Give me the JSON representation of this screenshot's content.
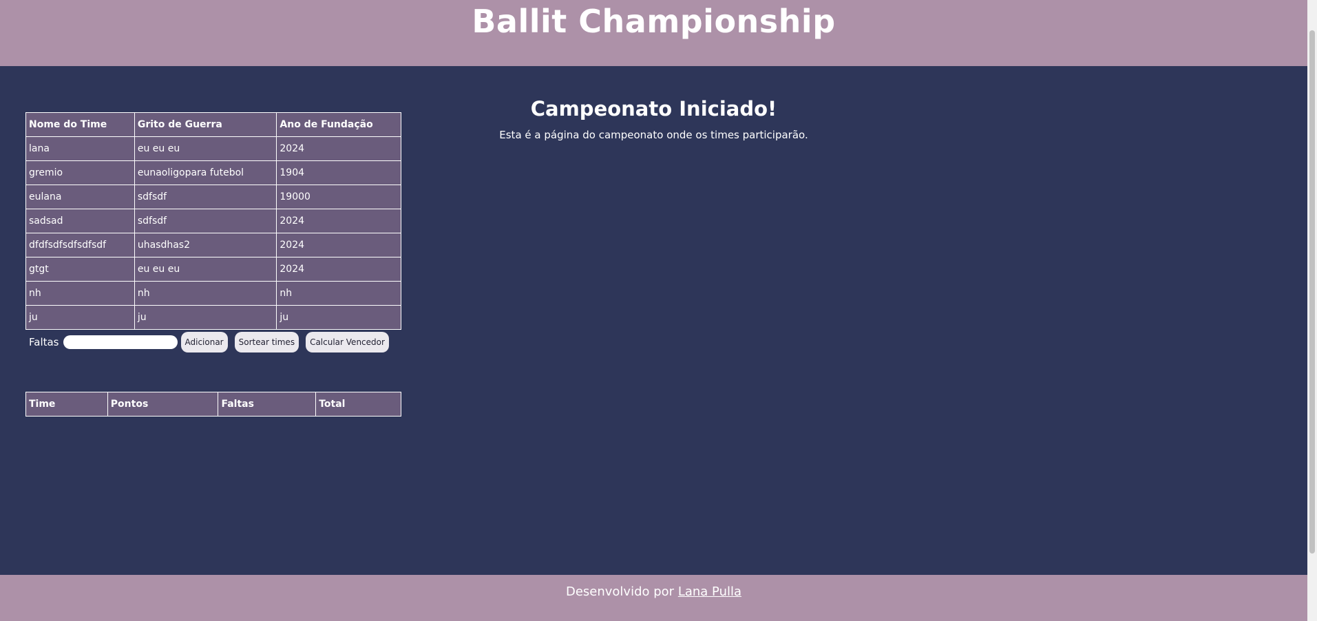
{
  "header": {
    "title": "Ballit Championship"
  },
  "main": {
    "title": "Campeonato Iniciado!",
    "subtitle": "Esta é a página do campeonato onde os times participarão."
  },
  "teams_table": {
    "headers": [
      "Nome do Time",
      "Grito de Guerra",
      "Ano de Fundação"
    ],
    "rows": [
      [
        "lana",
        "eu eu eu",
        "2024"
      ],
      [
        "gremio",
        "eunaoligopara futebol",
        "1904"
      ],
      [
        "eulana",
        "sdfsdf",
        "19000"
      ],
      [
        "sadsad",
        "sdfsdf",
        "2024"
      ],
      [
        "dfdfsdfsdfsdfsdf",
        "uhasdhas2",
        "2024"
      ],
      [
        "gtgt",
        "eu eu eu",
        "2024"
      ],
      [
        "nh",
        "nh",
        "nh"
      ],
      [
        "ju",
        "ju",
        "ju"
      ]
    ]
  },
  "controls": {
    "faltas_label": "Faltas",
    "faltas_value": "",
    "add_label": "Adicionar",
    "shuffle_label": "Sortear times",
    "winner_label": "Calcular Vencedor"
  },
  "results_table": {
    "headers": [
      "Time",
      "Pontos",
      "Faltas",
      "Total"
    ],
    "rows": []
  },
  "footer": {
    "prefix": "Desenvolvido por",
    "author": "Lana Pulla"
  },
  "colors": {
    "header_bg": "#ad91a8",
    "main_bg": "#2e3659",
    "table_cell_bg": "#6a5c7c"
  }
}
